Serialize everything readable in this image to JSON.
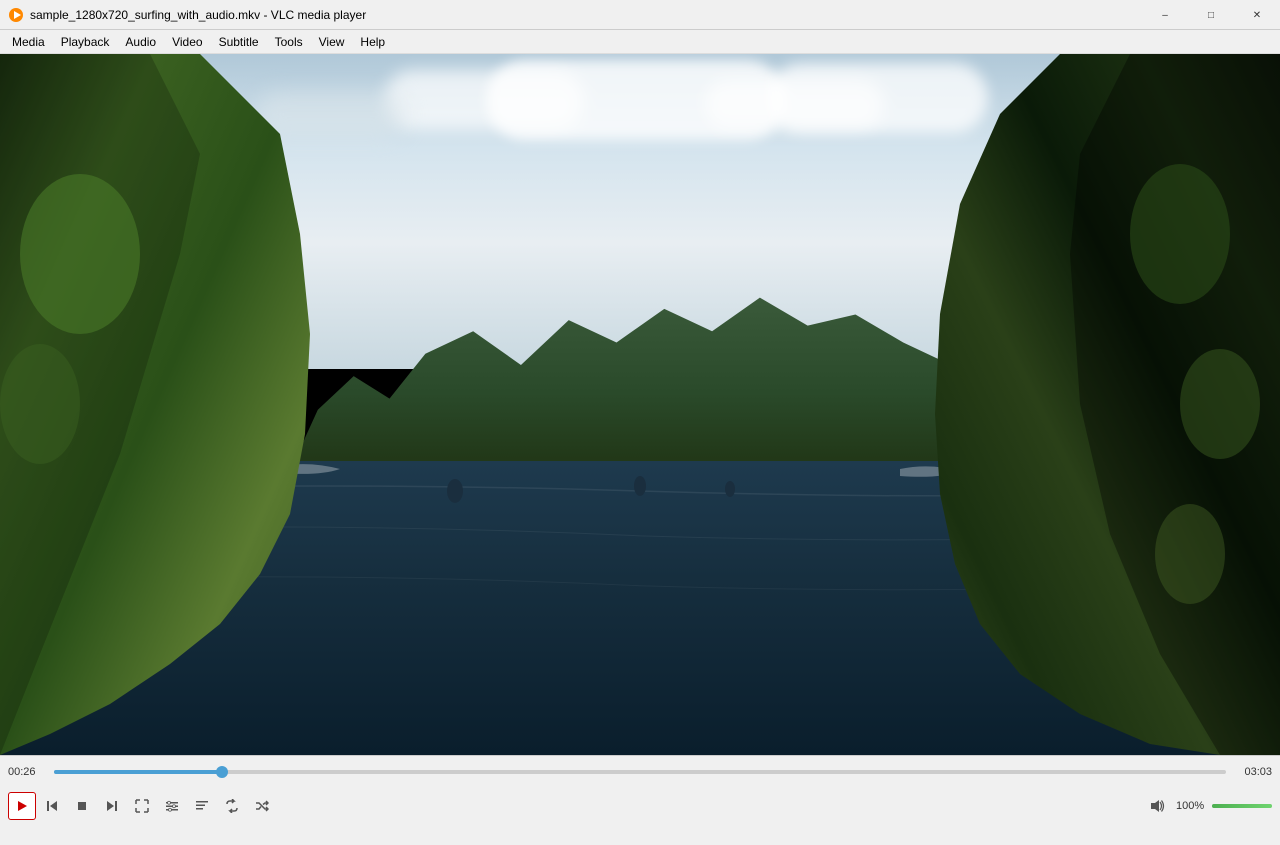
{
  "titleBar": {
    "icon": "🎥",
    "title": "sample_1280x720_surfing_with_audio.mkv - VLC media player"
  },
  "windowControls": {
    "minimize": "–",
    "maximize": "□",
    "close": "✕"
  },
  "menuBar": {
    "items": [
      "Media",
      "Playback",
      "Audio",
      "Video",
      "Subtitle",
      "Tools",
      "View",
      "Help"
    ]
  },
  "controls": {
    "timeCurrent": "00:26",
    "timeTotal": "03:03",
    "progressPercent": 14.3,
    "progressHandlePercent": 14.3,
    "volumePercent": 100,
    "volumeLabel": "100%"
  },
  "buttons": {
    "play": "▶",
    "skipBack": "⏮",
    "stop": "⏹",
    "skipForward": "⏭",
    "fullscreen": "⛶",
    "extControls": "⚙",
    "playlist": "☰",
    "loop": "↻",
    "random": "⇄"
  }
}
